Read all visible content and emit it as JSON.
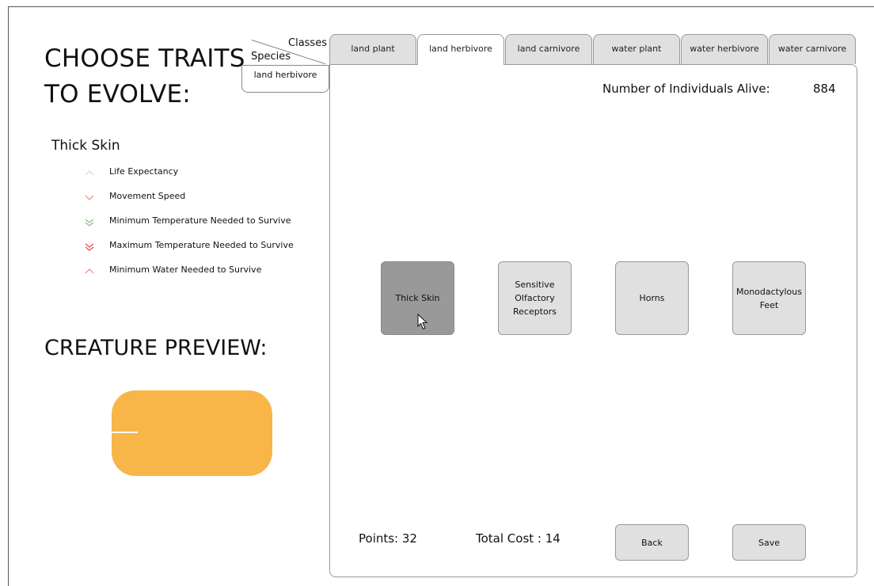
{
  "heading": {
    "line1": "CHOOSE TRAITS",
    "line2": "TO EVOLVE:"
  },
  "selected_trait": {
    "name": "Thick Skin",
    "effects": [
      {
        "label": "Life Expectancy",
        "icon": "chevron-up-icon",
        "color": "#dddddd"
      },
      {
        "label": "Movement Speed",
        "icon": "chevron-down-icon",
        "color": "#e89a94"
      },
      {
        "label": "Minimum Temperature Needed to Survive",
        "icon": "double-chevron-down-icon",
        "color": "#8cc48a"
      },
      {
        "label": "Maximum Temperature Needed to Survive",
        "icon": "double-chevron-down-icon",
        "color": "#e2574c"
      },
      {
        "label": "Minimum Water Needed to Survive",
        "icon": "chevron-up-icon",
        "color": "#e89a94"
      }
    ]
  },
  "preview": {
    "title": "CREATURE PREVIEW:",
    "body_color": "#f8b548"
  },
  "corner": {
    "classes_label": "Classes",
    "species_label": "Species",
    "species_value": "land herbivore"
  },
  "tabs": [
    {
      "label": "land plant"
    },
    {
      "label": "land herbivore",
      "active": true
    },
    {
      "label": "land carnivore"
    },
    {
      "label": "water plant"
    },
    {
      "label": "water herbivore"
    },
    {
      "label": "water carnivore"
    }
  ],
  "stats": {
    "alive_label": "Number of Individuals Alive:",
    "alive_count": "884"
  },
  "traits": [
    {
      "label": "Thick Skin",
      "selected": true
    },
    {
      "label": "Sensitive\nOlfactory\nReceptors"
    },
    {
      "label": "Horns"
    },
    {
      "label": "Monodactylous\nFeet"
    }
  ],
  "footer": {
    "points": "Points: 32",
    "total_cost": "Total Cost : 14",
    "back_label": "Back",
    "save_label": "Save"
  }
}
